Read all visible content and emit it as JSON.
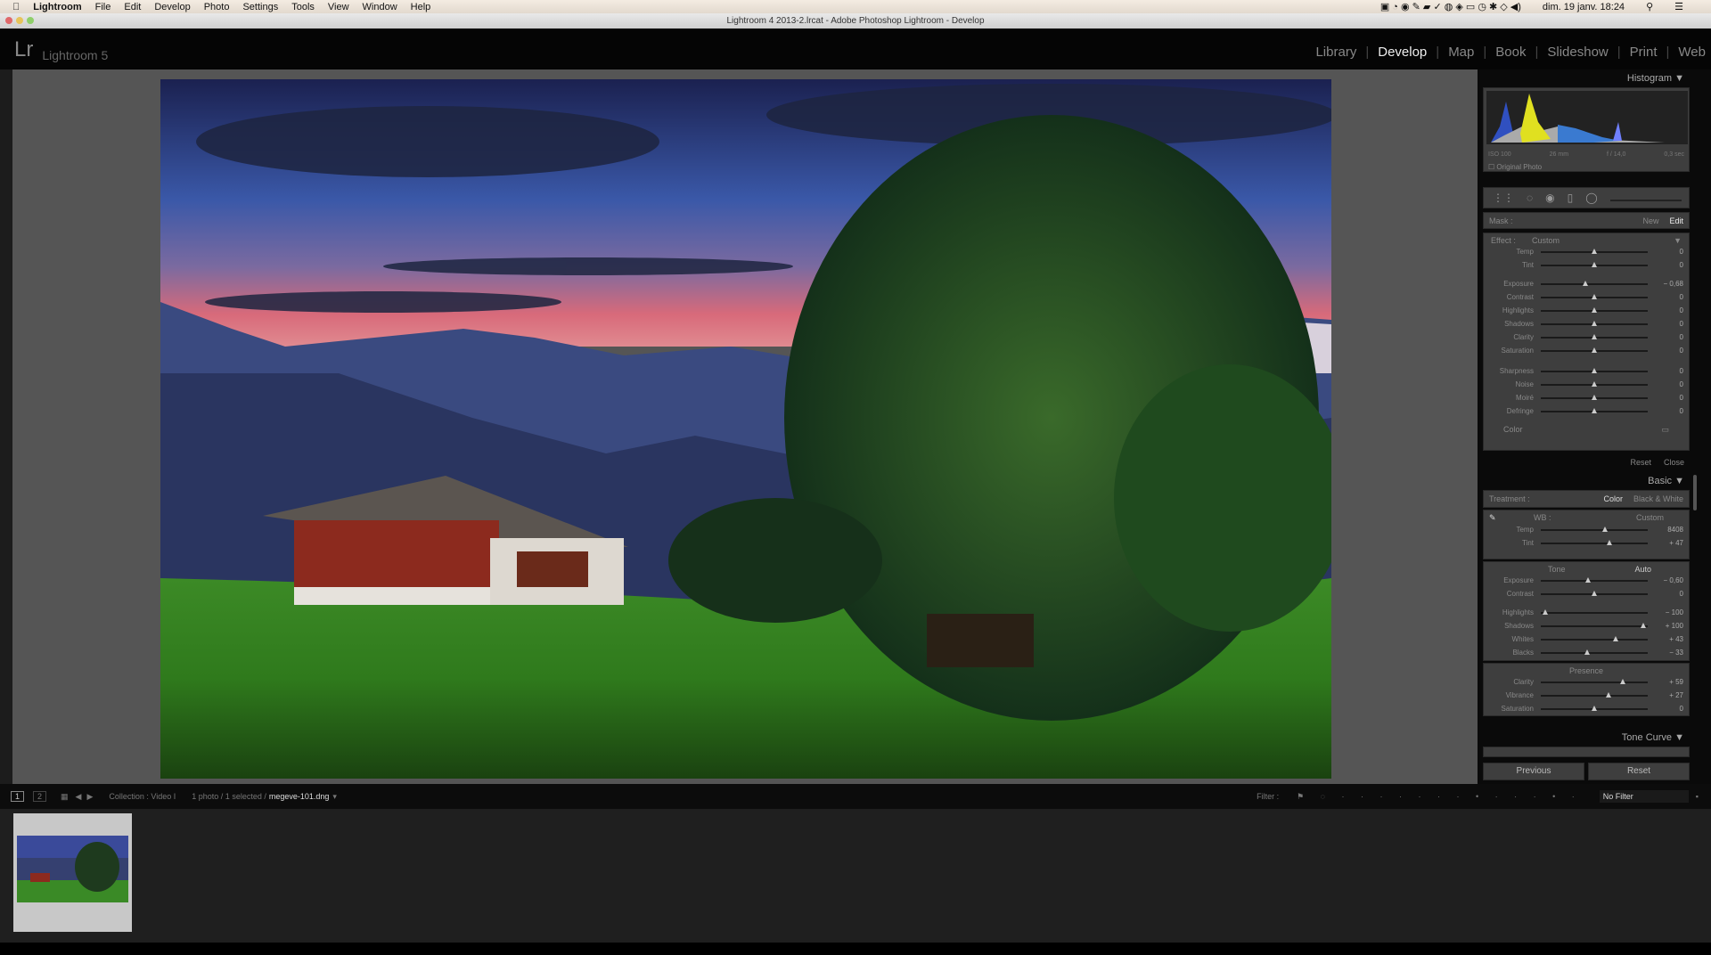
{
  "menubar": {
    "app": "Lightroom",
    "items": [
      "File",
      "Edit",
      "Develop",
      "Photo",
      "Settings",
      "Tools",
      "View",
      "Window",
      "Help"
    ],
    "clock": "dim. 19 janv.  18:24"
  },
  "titlebar": {
    "title": "Lightroom 4 2013-2.lrcat - Adobe Photoshop Lightroom - Develop"
  },
  "header": {
    "logo": "Lr",
    "product": "Lightroom 5",
    "modules": [
      "Library",
      "Develop",
      "Map",
      "Book",
      "Slideshow",
      "Print",
      "Web"
    ],
    "active": "Develop"
  },
  "histogram": {
    "title": "Histogram",
    "iso": "ISO 100",
    "focal": "26 mm",
    "aperture": "f / 14,0",
    "shutter": "0,3 sec",
    "original_photo": "Original Photo"
  },
  "mask": {
    "label": "Mask :",
    "new": "New",
    "edit": "Edit",
    "effect_label": "Effect :",
    "effect_value": "Custom",
    "sliders": [
      {
        "label": "Temp",
        "value": "0",
        "pos": 0.5
      },
      {
        "label": "Tint",
        "value": "0",
        "pos": 0.5
      },
      {
        "label": "Exposure",
        "value": "− 0,68",
        "pos": 0.42
      },
      {
        "label": "Contrast",
        "value": "0",
        "pos": 0.5
      },
      {
        "label": "Highlights",
        "value": "0",
        "pos": 0.5
      },
      {
        "label": "Shadows",
        "value": "0",
        "pos": 0.5
      },
      {
        "label": "Clarity",
        "value": "0",
        "pos": 0.5
      },
      {
        "label": "Saturation",
        "value": "0",
        "pos": 0.5
      },
      {
        "label": "Sharpness",
        "value": "0",
        "pos": 0.5
      },
      {
        "label": "Noise",
        "value": "0",
        "pos": 0.5
      },
      {
        "label": "Moiré",
        "value": "0",
        "pos": 0.5
      },
      {
        "label": "Defringe",
        "value": "0",
        "pos": 0.5
      }
    ],
    "color_label": "Color",
    "reset": "Reset",
    "close": "Close"
  },
  "basic": {
    "title": "Basic",
    "treatment": "Treatment :",
    "color": "Color",
    "bw": "Black & White",
    "wb": "WB :",
    "wb_value": "Custom",
    "wb_sliders": [
      {
        "label": "Temp",
        "value": "8408",
        "pos": 0.6
      },
      {
        "label": "Tint",
        "value": "+ 47",
        "pos": 0.64
      }
    ],
    "tone": "Tone",
    "auto": "Auto",
    "tone_sliders": [
      {
        "label": "Exposure",
        "value": "− 0,60",
        "pos": 0.44
      },
      {
        "label": "Contrast",
        "value": "0",
        "pos": 0.5
      }
    ],
    "tone_sliders2": [
      {
        "label": "Highlights",
        "value": "− 100",
        "pos": 0.04
      },
      {
        "label": "Shadows",
        "value": "+ 100",
        "pos": 0.96
      },
      {
        "label": "Whites",
        "value": "+ 43",
        "pos": 0.7
      },
      {
        "label": "Blacks",
        "value": "− 33",
        "pos": 0.43
      }
    ],
    "presence": "Presence",
    "presence_sliders": [
      {
        "label": "Clarity",
        "value": "+ 59",
        "pos": 0.77
      },
      {
        "label": "Vibrance",
        "value": "+ 27",
        "pos": 0.63
      },
      {
        "label": "Saturation",
        "value": "0",
        "pos": 0.5
      }
    ]
  },
  "tone_curve": {
    "title": "Tone Curve"
  },
  "buttons": {
    "previous": "Previous",
    "reset": "Reset"
  },
  "filmbar": {
    "page1": "1",
    "page2": "2",
    "collection": "Collection : Video I",
    "selection": "1 photo / 1 selected /",
    "filename": "megeve-101.dng",
    "filter_label": "Filter :",
    "filter_value": "No Filter"
  }
}
